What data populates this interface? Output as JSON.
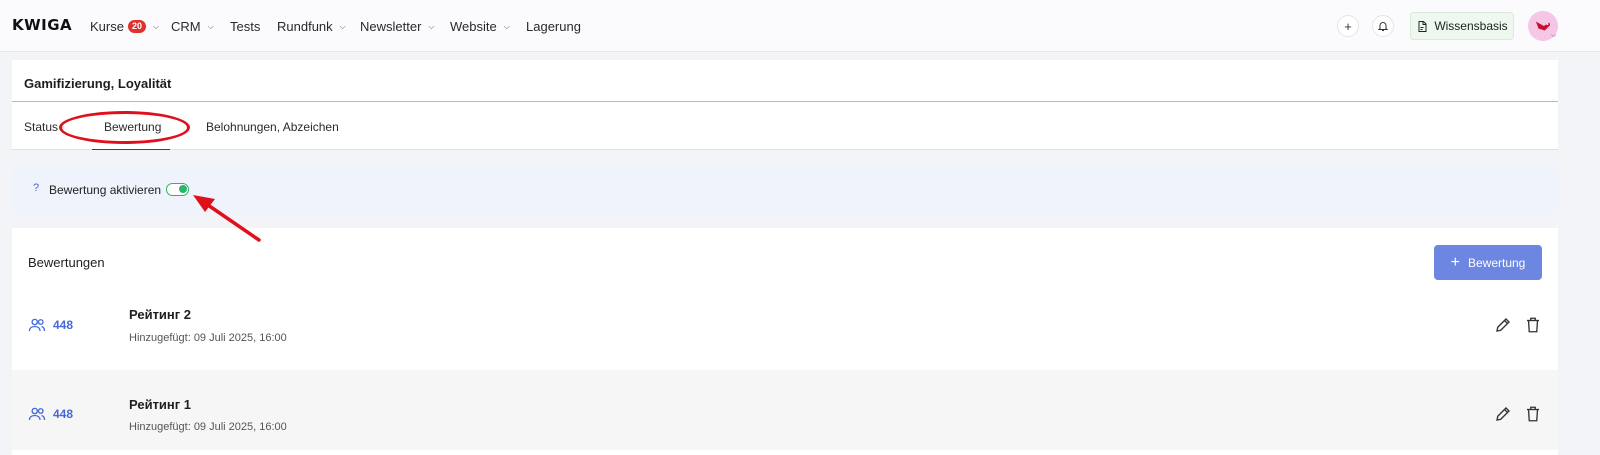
{
  "app": {
    "logo": "KWIGA"
  },
  "nav": [
    {
      "label": "Kurse",
      "badge": "20",
      "chevron": true
    },
    {
      "label": "CRM",
      "chevron": true
    },
    {
      "label": "Tests",
      "chevron": false
    },
    {
      "label": "Rundfunk",
      "chevron": true
    },
    {
      "label": "Newsletter",
      "chevron": true
    },
    {
      "label": "Website",
      "chevron": true
    },
    {
      "label": "Lagerung",
      "chevron": false
    }
  ],
  "header_actions": {
    "knowledge_base": "Wissensbasis"
  },
  "page": {
    "title": "Gamifizierung, Loyalität",
    "tabs": [
      {
        "label": "Status"
      },
      {
        "label": "Bewertung",
        "active": true
      },
      {
        "label": "Belohnungen, Abzeichen"
      }
    ]
  },
  "rating_toggle": {
    "help": "?",
    "label": "Bewertung aktivieren",
    "enabled": true
  },
  "ratings": {
    "title": "Bewertungen",
    "add_button": "Bewertung",
    "items": [
      {
        "count": "448",
        "name": "Рейтинг 2",
        "added": "Hinzugefügt: 09 Juli 2025, 16:00"
      },
      {
        "count": "448",
        "name": "Рейтинг 1",
        "added": "Hinzugefügt: 09 Juli 2025, 16:00"
      }
    ]
  },
  "colors": {
    "accent": "#6c86e2",
    "toggle_on": "#29b56a",
    "annotation": "#e0101b",
    "badge": "#e03131"
  }
}
